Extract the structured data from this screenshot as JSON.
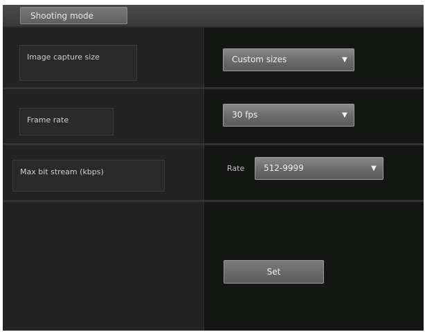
{
  "header": {
    "tab_label": "Shooting mode"
  },
  "rows": [
    {
      "label": "Image capture size",
      "sublabel": "",
      "value": "Custom sizes"
    },
    {
      "label": "Frame rate",
      "sublabel": "",
      "value": "30 fps"
    },
    {
      "label": "Max bit stream (kbps)",
      "sublabel": "",
      "prefix": "Rate",
      "value": "512-9999"
    }
  ],
  "footer": {
    "set_label": "Set"
  },
  "icons": {
    "dropdown": "chevron-down-icon"
  },
  "colors": {
    "background": "#1c1c1c",
    "control": "#6a6a6a"
  }
}
